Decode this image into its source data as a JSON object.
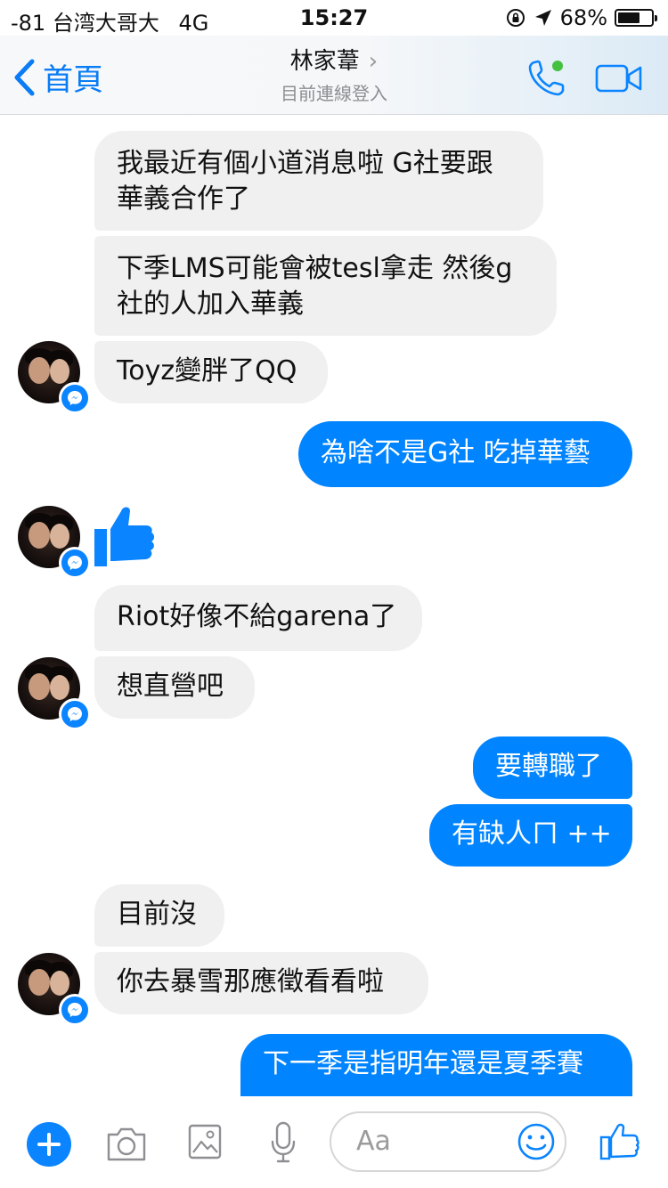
{
  "status": {
    "carrier": "-81 台湾大哥大",
    "network": "4G",
    "time": "15:27",
    "battery": "68%",
    "battery_level": 0.68
  },
  "header": {
    "back_label": "首頁",
    "contact_name": "林家葦",
    "subtitle": "目前連線登入"
  },
  "messages": [
    {
      "id": "m1",
      "side": "in",
      "text": "我最近有個小道消息啦 G社要跟",
      "text2": "華義合作了"
    },
    {
      "id": "m2",
      "side": "in",
      "text": "下季LMS可能會被tesl拿走 然後g",
      "text2": "社的人加入華義"
    },
    {
      "id": "m3",
      "side": "in",
      "text": "Toyz變胖了QQ"
    },
    {
      "id": "m4",
      "side": "out",
      "text": "為啥不是G社 吃掉華藝"
    },
    {
      "id": "m5",
      "side": "in",
      "type": "like"
    },
    {
      "id": "m6",
      "side": "in",
      "text": "Riot好像不給garena了"
    },
    {
      "id": "m7",
      "side": "in",
      "text": "想直營吧"
    },
    {
      "id": "m8",
      "side": "out",
      "text": "要轉職了"
    },
    {
      "id": "m9",
      "side": "out",
      "text": "有缺人ㄇ ++"
    },
    {
      "id": "m10",
      "side": "in",
      "text": "目前沒"
    },
    {
      "id": "m11",
      "side": "in",
      "text": "你去暴雪那應徵看看啦"
    },
    {
      "id": "m12",
      "side": "out",
      "text": "下一季是指明年還是夏季賽"
    }
  ],
  "composer": {
    "placeholder": "Aa"
  },
  "colors": {
    "accent": "#0084ff",
    "incoming_bubble": "#f1f0f0",
    "online_dot": "#44c140"
  }
}
